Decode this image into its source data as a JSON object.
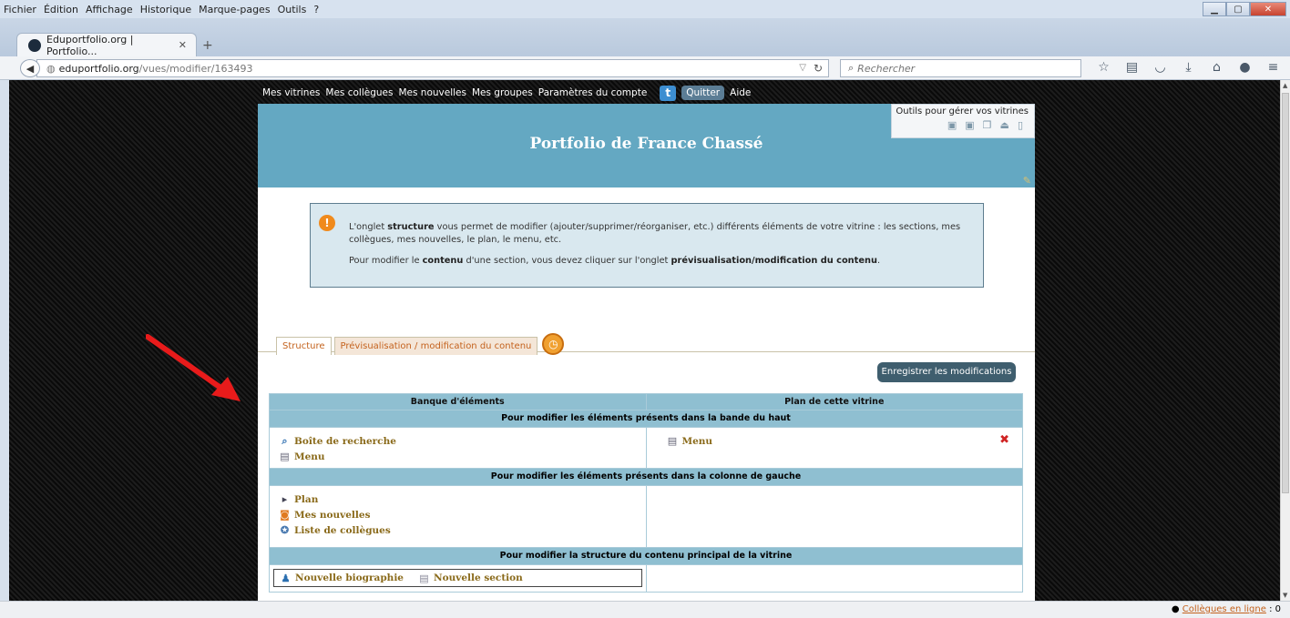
{
  "menubar": {
    "items": [
      "Fichier",
      "Édition",
      "Affichage",
      "Historique",
      "Marque-pages",
      "Outils",
      "?"
    ]
  },
  "browser": {
    "tab_title": "Eduportfolio.org | Portfolio...",
    "url_host": "eduportfolio.org",
    "url_path": "/vues/modifier/163493",
    "search_placeholder": "Rechercher"
  },
  "sitenav": {
    "links": [
      "Mes vitrines",
      "Mes collègues",
      "Mes nouvelles",
      "Mes groupes",
      "Paramètres du compte"
    ],
    "twitter_glyph": "t",
    "quit": "Quitter",
    "help": "Aide"
  },
  "banner": {
    "title": "Portfolio de France Chassé",
    "tools_label": "Outils pour gérer vos vitrines"
  },
  "info": {
    "p1_pre": "L'onglet ",
    "p1_bold": "structure",
    "p1_post": " vous permet de modifier (ajouter/supprimer/réorganiser, etc.) différents éléments de votre vitrine : les sections, mes collègues, mes nouvelles, le plan, le menu, etc.",
    "p2_pre": "Pour modifier le ",
    "p2_bold1": "contenu",
    "p2_mid": " d'une section, vous devez cliquer sur l'onglet ",
    "p2_bold2": "prévisualisation/modification du contenu",
    "p2_post": "."
  },
  "tabs": {
    "structure": "Structure",
    "preview": "Prévisualisation / modification du contenu"
  },
  "save_button": "Enregistrer les modifications",
  "table": {
    "col_left": "Banque d'éléments",
    "col_right": "Plan de cette vitrine",
    "sec_top": "Pour modifier les éléments présents dans la bande du haut",
    "sec_left": "Pour modifier les éléments présents dans la colonne de gauche",
    "sec_main": "Pour modifier la structure du contenu principal de la vitrine",
    "top_left_items": [
      "Boîte de recherche",
      "Menu"
    ],
    "top_right_items": [
      "Menu"
    ],
    "left_items": [
      "Plan",
      "Mes nouvelles",
      "Liste de collègues"
    ],
    "main_items": [
      "Nouvelle biographie",
      "Nouvelle section"
    ]
  },
  "status": {
    "colleagues_label": "Collègues en ligne",
    "colleagues_count": ": 0"
  },
  "colors": {
    "banner": "#64a8c2",
    "table_header": "#8fbfd1",
    "accent_orange": "#c4621d",
    "save_button": "#3f5e6e",
    "arrow": "#e81b1b"
  }
}
